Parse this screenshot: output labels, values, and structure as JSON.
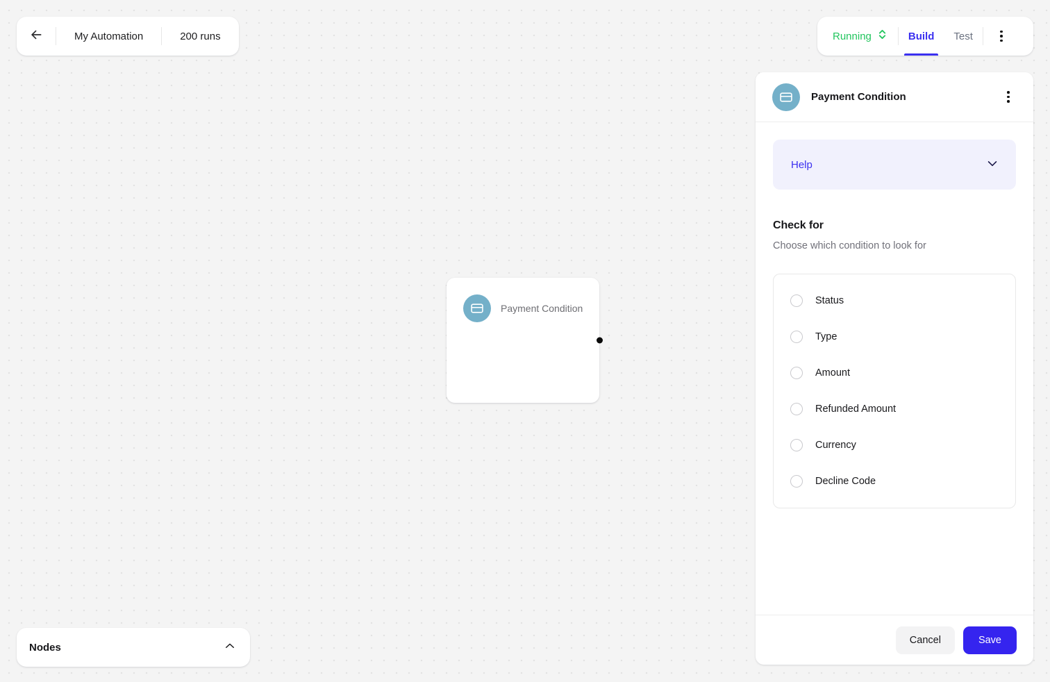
{
  "toolbar": {
    "back_icon": "arrow-left-icon",
    "automation_name": "My Automation",
    "runs_label": "200 runs"
  },
  "header": {
    "status": {
      "label": "Running",
      "color": "#22c55e",
      "selector_icon": "chevron-up-down-icon"
    },
    "tabs": [
      {
        "label": "Build",
        "active": true
      },
      {
        "label": "Test",
        "active": false
      }
    ],
    "overflow_icon": "kebab-menu-icon",
    "accent_color": "#3b30f0"
  },
  "canvas": {
    "node": {
      "icon": "credit-card-icon",
      "icon_bg": "#74b0c9",
      "title": "Payment Condition",
      "handle": "output-connector-handle"
    }
  },
  "nodes_panel": {
    "title": "Nodes",
    "toggle_icon": "chevron-up-icon"
  },
  "panel": {
    "icon": "credit-card-icon",
    "title": "Payment Condition",
    "overflow_icon": "kebab-menu-icon",
    "help": {
      "label": "Help",
      "expand_icon": "chevron-down-icon",
      "bg_color": "#f1f1fd",
      "text_color": "#3b30f0"
    },
    "section": {
      "title": "Check for",
      "subtitle": "Choose which condition to look for"
    },
    "options": [
      {
        "label": "Status",
        "selected": false
      },
      {
        "label": "Type",
        "selected": false
      },
      {
        "label": "Amount",
        "selected": false
      },
      {
        "label": "Refunded Amount",
        "selected": false
      },
      {
        "label": "Currency",
        "selected": false
      },
      {
        "label": "Decline Code",
        "selected": false
      }
    ],
    "footer": {
      "cancel_label": "Cancel",
      "save_label": "Save",
      "save_color": "#3524ef"
    }
  }
}
